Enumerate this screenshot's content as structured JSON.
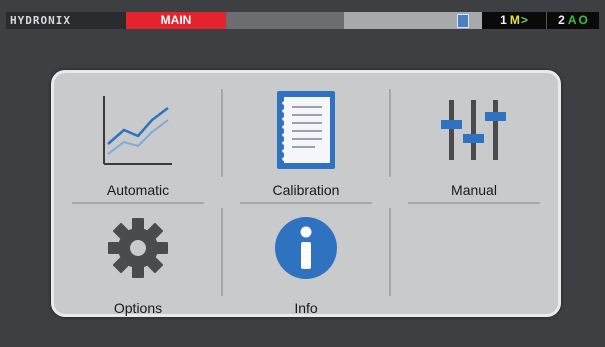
{
  "status_bar": {
    "logo": "HYDRONIX",
    "mode": "MAIN",
    "indicator1": {
      "num": "1",
      "letter": "M",
      "arrow": ">"
    },
    "indicator2": {
      "num": "2",
      "letter": "A",
      "state": "O"
    },
    "colors": {
      "mode_bg": "#e3232d",
      "accent_green": "#35c23d",
      "accent_yellow": "#e8e233",
      "card_blue": "#4a7fc0"
    }
  },
  "menu": {
    "tiles": [
      {
        "label": "Automatic",
        "icon": "trend-chart-icon"
      },
      {
        "label": "Calibration",
        "icon": "notebook-icon"
      },
      {
        "label": "Manual",
        "icon": "sliders-icon"
      },
      {
        "label": "Options",
        "icon": "gear-icon"
      },
      {
        "label": "Info",
        "icon": "info-icon"
      }
    ],
    "colors": {
      "icon_blue": "#2f72bf",
      "icon_gray": "#4a4b4d"
    }
  }
}
